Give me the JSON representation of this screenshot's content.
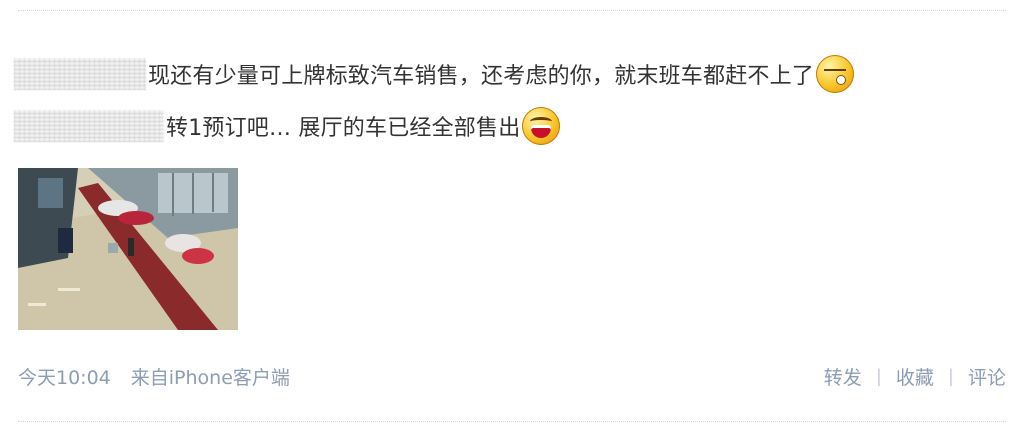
{
  "post": {
    "line1": "现还有少量可上牌标致汽车销售，还考虑的你，就末班车都赶不上了",
    "line2": "转1预订吧… 展厅的车已经全部售出",
    "emoji1": "sleepy-face-icon",
    "emoji2": "laughing-face-icon"
  },
  "footer": {
    "time": "今天10:04",
    "source": "来自iPhone客户端",
    "repost": "转发",
    "separator": "|",
    "favorite": "收藏",
    "comment": "评论"
  },
  "colors": {
    "text": "#333333",
    "meta": "#8d9db5"
  }
}
